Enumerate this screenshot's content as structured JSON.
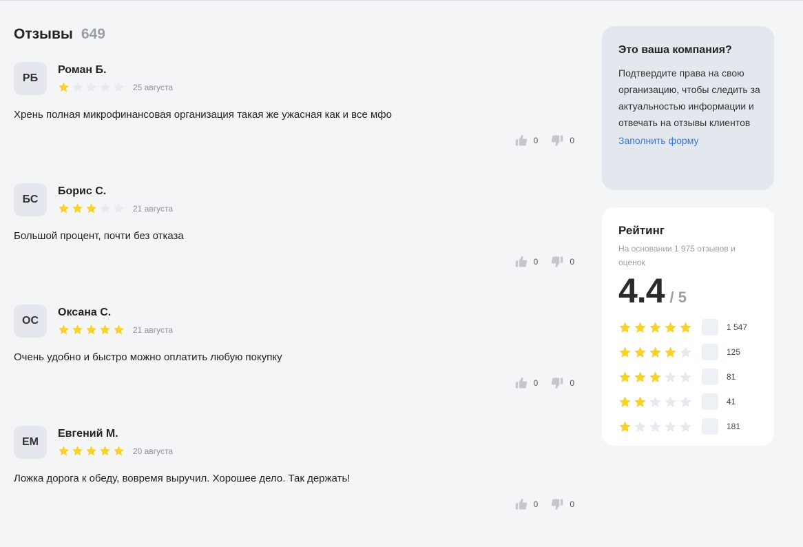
{
  "reviews": {
    "title": "Отзывы",
    "count": "649",
    "items": [
      {
        "initials": "РБ",
        "author": "Роман Б.",
        "rating": 1,
        "date": "25 августа",
        "text": "Хрень полная микрофинансовая организация такая же ужасная как и все мфо",
        "likes": "0",
        "dislikes": "0"
      },
      {
        "initials": "БС",
        "author": "Борис С.",
        "rating": 3,
        "date": "21 августа",
        "text": "Большой процент, почти без отказа",
        "likes": "0",
        "dislikes": "0"
      },
      {
        "initials": "ОС",
        "author": "Оксана С.",
        "rating": 5,
        "date": "21 августа",
        "text": "Очень удобно и быстро можно оплатить любую покупку",
        "likes": "0",
        "dislikes": "0"
      },
      {
        "initials": "ЕМ",
        "author": "Евгений М.",
        "rating": 5,
        "date": "20 августа",
        "text": "Ложка дорога к обеду, вовремя выручил. Хорошее дело. Так держать!",
        "likes": "0",
        "dislikes": "0"
      }
    ]
  },
  "claim": {
    "title": "Это ваша компания?",
    "text": "Подтвердите права на свою организацию, чтобы следить за актуальностью информации и отвечать на отзывы клиентов",
    "link": "Заполнить форму"
  },
  "rating": {
    "title": "Рейтинг",
    "subtitle": "На основании 1 975 отзывов и оценок",
    "value": "4.4",
    "max": "/ 5",
    "distribution": [
      {
        "stars": 5,
        "count": "1 547"
      },
      {
        "stars": 4,
        "count": "125"
      },
      {
        "stars": 3,
        "count": "81"
      },
      {
        "stars": 2,
        "count": "41"
      },
      {
        "stars": 1,
        "count": "181"
      }
    ]
  },
  "colors": {
    "star_filled": "#f7d325",
    "star_empty": "#e6eaf0",
    "link": "#3a77d0",
    "thumb": "#c4c8ce"
  },
  "icons": {
    "star": "star-icon",
    "like": "thumbs-up-icon",
    "dislike": "thumbs-down-icon"
  }
}
